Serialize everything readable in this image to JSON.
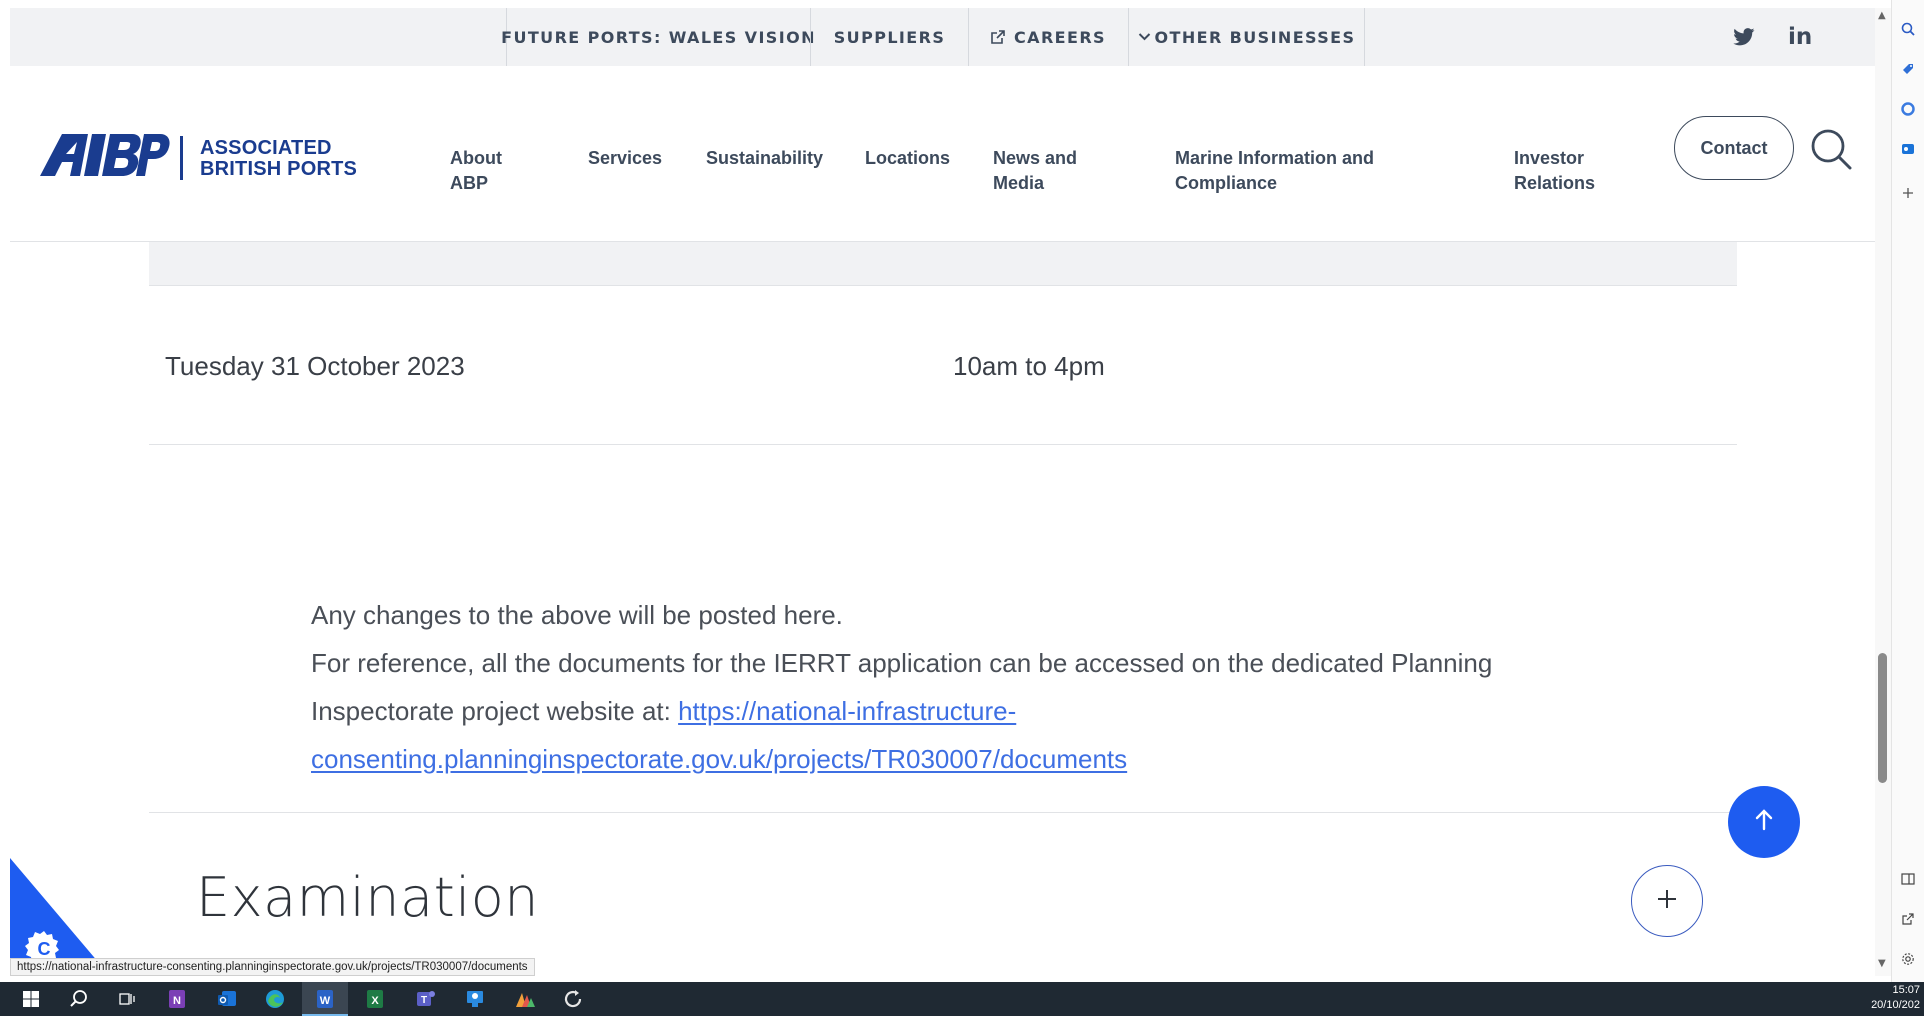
{
  "utility_bar": {
    "items": [
      {
        "label": "FUTURE PORTS: WALES VISION"
      },
      {
        "label": "SUPPLIERS"
      },
      {
        "label": "CAREERS",
        "icon": "external-link-icon"
      },
      {
        "label": "OTHER BUSINESSES",
        "icon": "chevron-down-icon"
      }
    ],
    "social": {
      "twitter_icon": "twitter-icon",
      "linkedin_label": "in"
    }
  },
  "header": {
    "logo_abbr": "ABP",
    "logo_line1": "ASSOCIATED",
    "logo_line2": "BRITISH PORTS",
    "nav": [
      {
        "line1": "About",
        "line2": "ABP"
      },
      {
        "line1": "Services",
        "line2": ""
      },
      {
        "line1": "Sustainability",
        "line2": ""
      },
      {
        "line1": "Locations",
        "line2": ""
      },
      {
        "line1": "News and",
        "line2": "Media"
      },
      {
        "line1": "Marine Information and",
        "line2": "Compliance"
      },
      {
        "line1": "Investor",
        "line2": "Relations"
      }
    ],
    "contact_label": "Contact",
    "search_icon": "search-icon"
  },
  "schedule": {
    "date": "Tuesday 31 October 2023",
    "time": "10am to 4pm"
  },
  "notice": {
    "line1": "Any changes to the above will be posted here.",
    "line2": "For reference, all the documents for the IERRT application can be accessed on the dedicated Planning Inspectorate project website at: ",
    "link_text": "https://national-infrastructure-consenting.planninginspectorate.gov.uk/projects/TR030007/documents"
  },
  "section": {
    "title": "Examination",
    "expand_icon": "plus-icon"
  },
  "back_to_top_icon": "arrow-up-icon",
  "cookie_icon": "cookie-settings-icon",
  "status_url": "https://national-infrastructure-consenting.planninginspectorate.gov.uk/projects/TR030007/documents",
  "taskbar": {
    "time": "15:07",
    "date": "20/10/202"
  },
  "colors": {
    "brand_navy": "#1a3c8f",
    "accent_blue": "#1e5cf0",
    "link_blue": "#3e6fe3",
    "text_gray": "#3d4a5c"
  }
}
